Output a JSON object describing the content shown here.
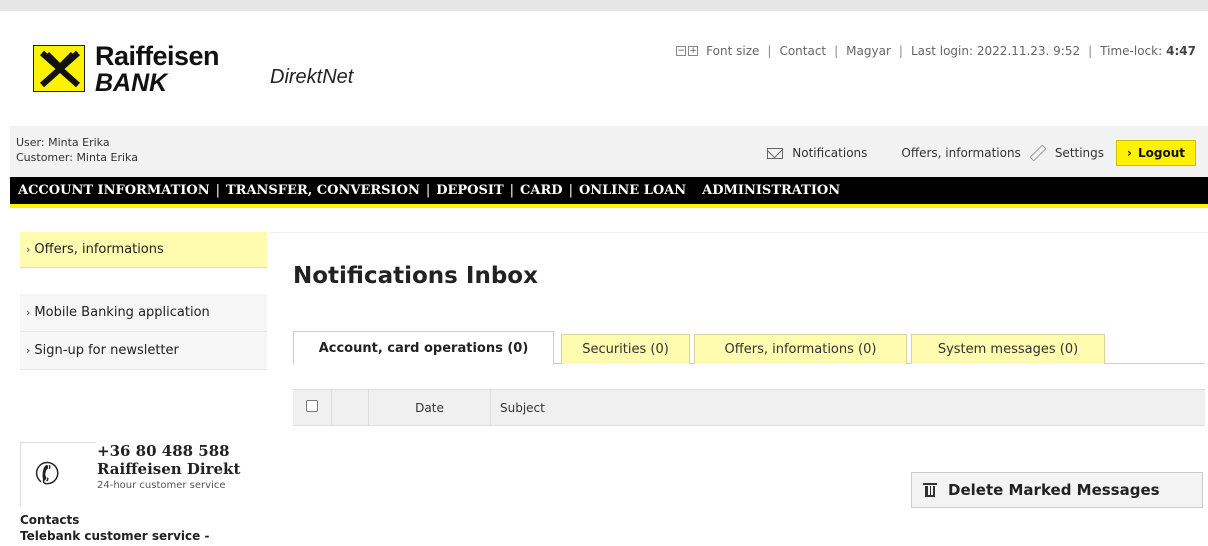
{
  "brand": {
    "name_line1": "Raiffeisen",
    "name_line2": "BANK",
    "product": "DirektNet"
  },
  "toplinks": {
    "font_minus": "−",
    "font_plus": "+",
    "font_size_label": "Font size",
    "contact": "Contact",
    "language": "Magyar",
    "last_login": "Last login: 2022.11.23. 9:52",
    "time_lock_label": "Time-lock:",
    "time_lock_value": "4:47"
  },
  "user": {
    "user_line": "User: Minta Erika",
    "customer_line": "Customer: Minta Erika"
  },
  "user_actions": {
    "notifications": "Notifications",
    "offers": "Offers, informations",
    "settings": "Settings",
    "logout": "Logout"
  },
  "main_nav": [
    {
      "label": "ACCOUNT INFORMATION"
    },
    {
      "label": "TRANSFER, CONVERSION"
    },
    {
      "label": "DEPOSIT"
    },
    {
      "label": "CARD"
    },
    {
      "label": "ONLINE LOAN"
    },
    {
      "label": "ADMINISTRATION"
    }
  ],
  "sidebar": {
    "items": [
      {
        "label": "Offers, informations",
        "active": true
      },
      {
        "label": "Mobile Banking application"
      },
      {
        "label": "Sign-up for newsletter"
      }
    ]
  },
  "contact_box": {
    "phone": "+36 80 488 588",
    "name": "Raiffeisen Direkt",
    "subtitle": "24-hour customer service",
    "contacts_title": "Contacts",
    "contacts_line": "Telebank customer service -"
  },
  "page": {
    "title": "Notifications Inbox"
  },
  "tabs": [
    {
      "label": "Account, card operations (0)",
      "active": true
    },
    {
      "label": "Securities (0)"
    },
    {
      "label": "Offers, informations (0)"
    },
    {
      "label": "System messages (0)"
    }
  ],
  "table": {
    "columns": [
      "",
      "",
      "Date",
      "Subject"
    ]
  },
  "actions": {
    "delete_marked": "Delete Marked Messages"
  },
  "colors": {
    "brand_yellow": "#fff200",
    "nav_black": "#000000",
    "tab_yellow": "#fffcb0"
  }
}
